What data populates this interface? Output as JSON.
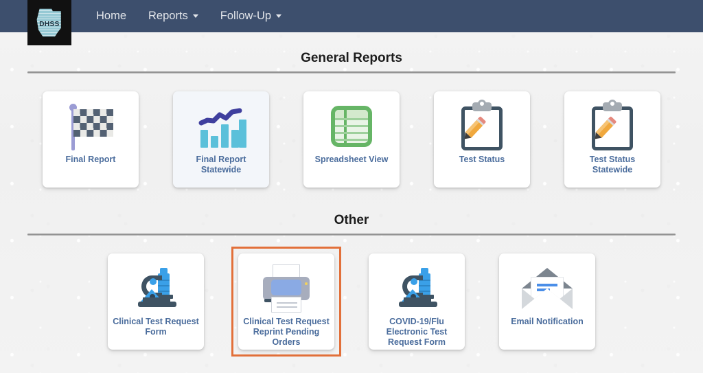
{
  "navbar": {
    "logo": {
      "icon": "missouri-dhss-logo",
      "text": "DHSS"
    },
    "items": [
      {
        "label": "Home",
        "has_caret": false
      },
      {
        "label": "Reports",
        "has_caret": true
      },
      {
        "label": "Follow-Up",
        "has_caret": true
      }
    ]
  },
  "sections": [
    {
      "title": "General Reports",
      "cards": [
        {
          "label": "Final Report",
          "icon": "checkered-flag-icon",
          "hovered": false,
          "selected": false
        },
        {
          "label": "Final Report Statewide",
          "icon": "bar-chart-trend-icon",
          "hovered": true,
          "selected": false
        },
        {
          "label": "Spreadsheet View",
          "icon": "spreadsheet-grid-icon",
          "hovered": false,
          "selected": false
        },
        {
          "label": "Test Status",
          "icon": "clipboard-pencil-icon",
          "hovered": false,
          "selected": false
        },
        {
          "label": "Test Status Statewide",
          "icon": "clipboard-pencil-icon",
          "hovered": false,
          "selected": false
        }
      ]
    },
    {
      "title": "Other",
      "cards": [
        {
          "label": "Clinical Test Request Form",
          "icon": "microscope-icon",
          "hovered": false,
          "selected": false
        },
        {
          "label": "Clinical Test Request Reprint Pending Orders",
          "icon": "printer-icon",
          "hovered": false,
          "selected": true
        },
        {
          "label": "COVID-19/Flu Electronic Test Request Form",
          "icon": "microscope-icon",
          "hovered": false,
          "selected": false
        },
        {
          "label": "Email Notification",
          "icon": "open-envelope-icon",
          "hovered": false,
          "selected": false
        }
      ]
    }
  ],
  "colors": {
    "navbar_bg": "#3d4f6d",
    "card_label": "#4a6c9c",
    "selection_border": "#e2703a",
    "page_bg": "#f2f2f2",
    "spreadsheet_green": "#66b566",
    "microscope_blue": "#3aa0e8",
    "chart_bar_cyan": "#5bc0da",
    "chart_line_navy": "#3f3f9e",
    "pencil_orange": "#f0a83d"
  }
}
